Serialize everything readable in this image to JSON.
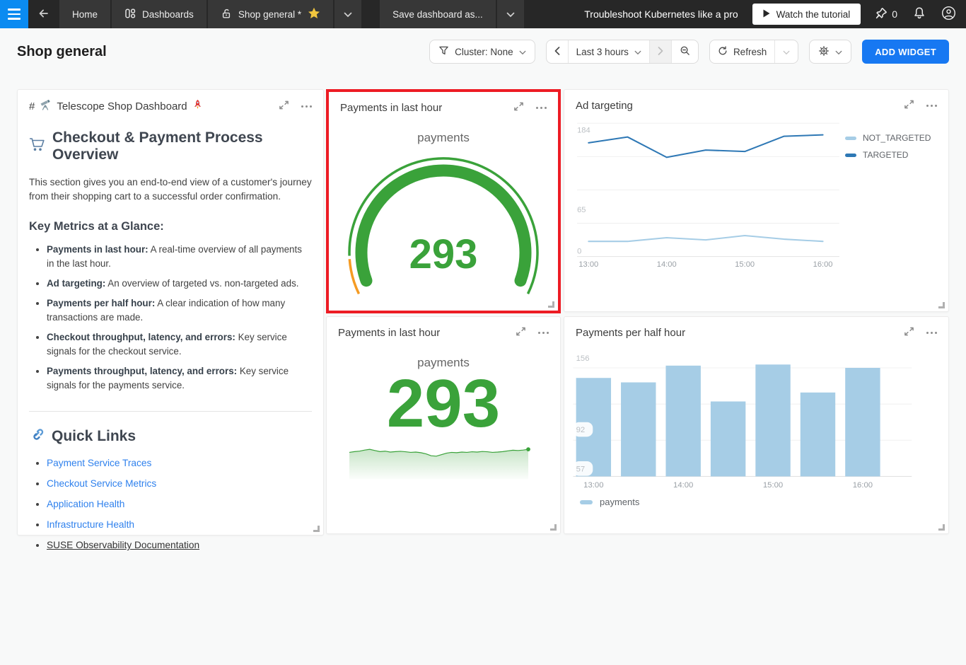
{
  "navbar": {
    "home_tab": "Home",
    "dashboards_tab": "Dashboards",
    "current_tab": "Shop general *",
    "save_label": "Save dashboard as...",
    "promo_text": "Troubleshoot Kubernetes like a pro",
    "watch_label": "Watch the tutorial",
    "pin_count": "0"
  },
  "header": {
    "title": "Shop general",
    "cluster_filter": "Cluster: None",
    "time_range": "Last 3 hours",
    "refresh_label": "Refresh",
    "add_widget": "ADD WIDGET"
  },
  "widgets": {
    "gauge_title": "Payments in last hour",
    "ad_title": "Ad targeting",
    "number_title": "Payments in last hour",
    "bar_title": "Payments per half hour"
  },
  "markdown_widget": {
    "title_prefix": "#",
    "title_emoji_1": "🔭",
    "title_text": "Telescope Shop Dashboard",
    "title_emoji_2": "🚀",
    "heading_emoji": "🛒",
    "heading_text": "Checkout & Payment Process Overview",
    "intro": "This section gives you an end-to-end view of a customer's journey from their shopping cart to a successful order confirmation.",
    "metrics_heading": "Key Metrics at a Glance:",
    "metrics": [
      {
        "term": "Payments in last hour:",
        "desc": "A real-time overview of all payments in the last hour."
      },
      {
        "term": "Ad targeting:",
        "desc": "An overview of targeted vs. non-targeted ads."
      },
      {
        "term": "Payments per half hour:",
        "desc": "A clear indication of how many transactions are made."
      },
      {
        "term": "Checkout throughput, latency, and errors:",
        "desc": "Key service signals for the checkout service."
      },
      {
        "term": "Payments throughput, latency, and errors:",
        "desc": "Key service signals for the payments service."
      }
    ],
    "links_emoji": "🔗",
    "links_heading": "Quick Links",
    "links": [
      {
        "label": "Payment Service Traces",
        "style": "link"
      },
      {
        "label": "Checkout Service Metrics",
        "style": "link"
      },
      {
        "label": "Application Health",
        "style": "link"
      },
      {
        "label": "Infrastructure Health",
        "style": "link"
      },
      {
        "label": "SUSE Observability Documentation",
        "style": "dark"
      }
    ]
  },
  "annotation": {
    "type": "highlight-box",
    "target": "Payments in last hour gauge widget",
    "color": "#ed1c24"
  },
  "chart_data": [
    {
      "widget": "Payments in last hour (gauge)",
      "type": "gauge",
      "label": "payments",
      "value": 293,
      "colors": {
        "main": "#3aa23a",
        "low": "#f59b23"
      }
    },
    {
      "widget": "Ad targeting",
      "type": "line",
      "x": [
        "13:00",
        "13:30",
        "14:00",
        "14:30",
        "15:00",
        "15:30",
        "16:00"
      ],
      "xticks": [
        0,
        2,
        4,
        6
      ],
      "series": [
        {
          "name": "NOT_TARGETED",
          "color": "#a6cde6",
          "values": [
            21,
            21,
            26,
            23,
            29,
            24,
            21
          ]
        },
        {
          "name": "TARGETED",
          "color": "#2e78b5",
          "values": [
            157,
            165,
            137,
            147,
            145,
            166,
            168
          ]
        }
      ],
      "yticks": [
        184,
        65,
        0
      ],
      "ylim": [
        0,
        184
      ],
      "legend_position": "right",
      "grid": true
    },
    {
      "widget": "Payments in last hour (number)",
      "type": "number",
      "label": "payments",
      "value": 293,
      "color": "#3aa23a",
      "sparkline": [
        0.5,
        0.45,
        0.42,
        0.35,
        0.3,
        0.38,
        0.45,
        0.42,
        0.48,
        0.45,
        0.43,
        0.46,
        0.5,
        0.48,
        0.52,
        0.6,
        0.72,
        0.75,
        0.65,
        0.55,
        0.5,
        0.52,
        0.48,
        0.5,
        0.46,
        0.48,
        0.44,
        0.46,
        0.5,
        0.48,
        0.45,
        0.4,
        0.36,
        0.38,
        0.35,
        0.3
      ]
    },
    {
      "widget": "Payments per half hour",
      "type": "bar",
      "categories": [
        "13:00",
        "13:30",
        "14:00",
        "14:30",
        "15:00",
        "15:30",
        "16:00"
      ],
      "xticks": [
        0,
        2,
        4,
        6
      ],
      "values": [
        138,
        134,
        149,
        117,
        150,
        125,
        147
      ],
      "yticks": [
        {
          "v": 156,
          "pill": false
        },
        {
          "v": 92,
          "pill": true
        },
        {
          "v": 57,
          "pill": true
        }
      ],
      "ylim": [
        50,
        160
      ],
      "color": "#a6cde6",
      "legend": [
        "payments"
      ],
      "legend_position": "bottom",
      "grid": true
    }
  ]
}
